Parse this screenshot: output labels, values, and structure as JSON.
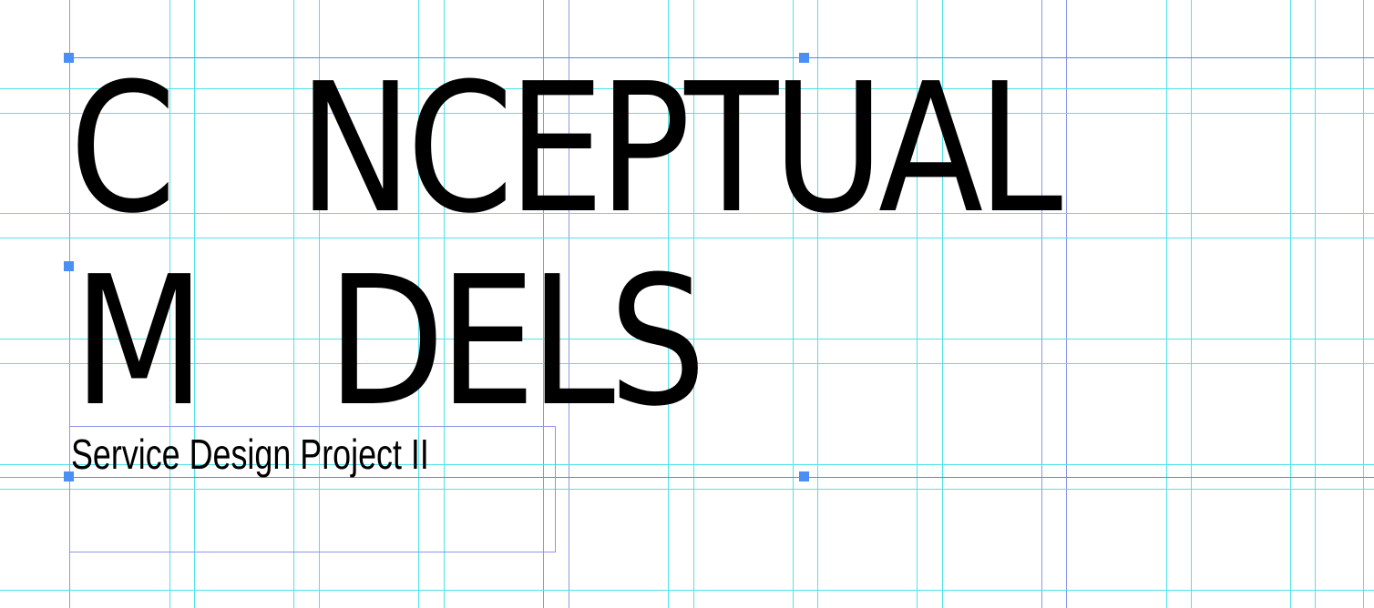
{
  "title": {
    "line1": "C   NCEPTUAL",
    "line2": "M   DELS"
  },
  "subtitle": "Service Design Project II",
  "colors": {
    "guide": "#4fe4ea",
    "column_guide": "#8e95ea",
    "selection": "#4a8ff5",
    "text": "#000000"
  }
}
